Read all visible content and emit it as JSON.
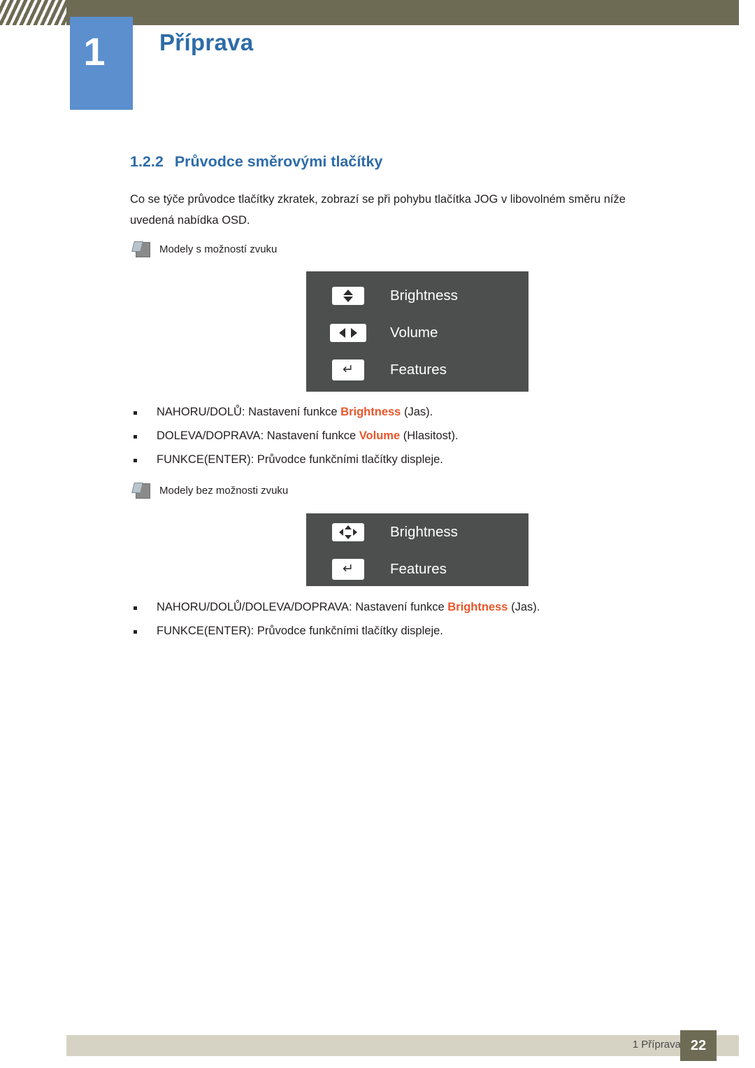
{
  "header": {
    "chapter_number": "1",
    "chapter_title": "Příprava"
  },
  "section": {
    "number": "1.2.2",
    "title": "Průvodce směrovými tlačítky",
    "paragraph": "Co se týče průvodce tlačítky zkratek, zobrazí se při pohybu tlačítka JOG v libovolném směru níže uvedená nabídka OSD."
  },
  "notes": {
    "with_sound": "Modely s možností zvuku",
    "without_sound": "Modely bez možnosti zvuku"
  },
  "osd_sound": {
    "rows": [
      {
        "key": "up-down-key",
        "label": "Brightness"
      },
      {
        "key": "left-right-key",
        "label": "Volume"
      },
      {
        "key": "enter-key",
        "label": "Features"
      }
    ]
  },
  "osd_nosound": {
    "rows": [
      {
        "key": "four-way-key",
        "label": "Brightness"
      },
      {
        "key": "enter-key",
        "label": "Features"
      }
    ]
  },
  "bullets_sound": [
    {
      "pre": "NAHORU/DOLŮ: Nastavení funkce ",
      "hl": "Brightness",
      "post": " (Jas)."
    },
    {
      "pre": "DOLEVA/DOPRAVA: Nastavení funkce ",
      "hl": "Volume",
      "post": " (Hlasitost)."
    },
    {
      "pre": "FUNKCE(ENTER): Průvodce funkčními tlačítky displeje.",
      "hl": "",
      "post": ""
    }
  ],
  "bullets_nosound": [
    {
      "pre": "NAHORU/DOLŮ/DOLEVA/DOPRAVA: Nastavení funkce ",
      "hl": "Brightness",
      "post": " (Jas)."
    },
    {
      "pre": "FUNKCE(ENTER): Průvodce funkčními tlačítky displeje.",
      "hl": "",
      "post": ""
    }
  ],
  "footer": {
    "label": "1 Příprava",
    "page": "22"
  },
  "colors": {
    "header_bar": "#6e6b55",
    "accent_blue": "#2e6ca8",
    "badge_blue": "#5b8fce",
    "osd_bg": "#4d4f4f",
    "highlight": "#e8562b",
    "footer_bar": "#d6d3c4"
  }
}
